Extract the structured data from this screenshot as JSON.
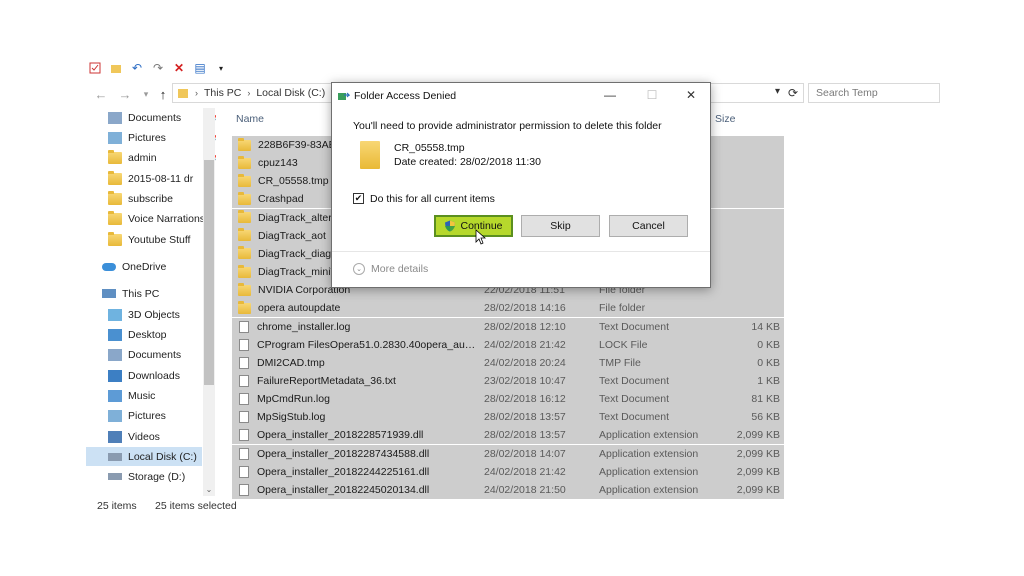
{
  "toolbar": {
    "icons": [
      "properties-icon",
      "folder-icon",
      "undo-icon",
      "redo-icon",
      "delete-icon",
      "rename-icon",
      "customize-dropdown-icon"
    ]
  },
  "address": {
    "crumbs": [
      "This PC",
      "Local Disk (C:)"
    ],
    "search_placeholder": "Search Temp"
  },
  "columns": {
    "name": "Name",
    "size": "Size"
  },
  "nav": {
    "quick_access": [
      {
        "label": "Documents",
        "pinned": true
      },
      {
        "label": "Pictures",
        "pinned": true
      },
      {
        "label": "admin",
        "pinned": true
      },
      {
        "label": "2015-08-11 dr",
        "pinned": false
      },
      {
        "label": "subscribe",
        "pinned": false
      },
      {
        "label": "Voice Narrations",
        "pinned": false
      },
      {
        "label": "Youtube Stuff",
        "pinned": false
      }
    ],
    "onedrive": "OneDrive",
    "this_pc": "This PC",
    "pc_items": [
      "3D Objects",
      "Desktop",
      "Documents",
      "Downloads",
      "Music",
      "Pictures",
      "Videos",
      "Local Disk (C:)",
      "Storage (D:)"
    ]
  },
  "files": [
    {
      "name": "228B6F39-83AB-4",
      "date": "",
      "type": "",
      "size": "",
      "kind": "folder"
    },
    {
      "name": "cpuz143",
      "date": "",
      "type": "",
      "size": "",
      "kind": "folder"
    },
    {
      "name": "CR_05558.tmp",
      "date": "",
      "type": "",
      "size": "",
      "kind": "folder"
    },
    {
      "name": "Crashpad",
      "date": "",
      "type": "",
      "size": "",
      "kind": "folder"
    },
    {
      "name": "DiagTrack_alternat",
      "date": "",
      "type": "",
      "size": "",
      "kind": "folder"
    },
    {
      "name": "DiagTrack_aot",
      "date": "",
      "type": "",
      "size": "",
      "kind": "folder"
    },
    {
      "name": "DiagTrack_diag",
      "date": "",
      "type": "",
      "size": "",
      "kind": "folder"
    },
    {
      "name": "DiagTrack_miniTra",
      "date": "",
      "type": "",
      "size": "",
      "kind": "folder"
    },
    {
      "name": "NVIDIA Corporation",
      "date": "22/02/2018 11:51",
      "type": "File folder",
      "size": "",
      "kind": "folder"
    },
    {
      "name": "opera autoupdate",
      "date": "28/02/2018 14:16",
      "type": "File folder",
      "size": "",
      "kind": "folder"
    },
    {
      "name": "chrome_installer.log",
      "date": "28/02/2018 12:10",
      "type": "Text Document",
      "size": "14 KB",
      "kind": "doc"
    },
    {
      "name": "CProgram FilesOpera51.0.2830.40opera_autou...",
      "date": "24/02/2018 21:42",
      "type": "LOCK File",
      "size": "0 KB",
      "kind": "doc"
    },
    {
      "name": "DMI2CAD.tmp",
      "date": "24/02/2018 20:24",
      "type": "TMP File",
      "size": "0 KB",
      "kind": "doc"
    },
    {
      "name": "FailureReportMetadata_36.txt",
      "date": "23/02/2018 10:47",
      "type": "Text Document",
      "size": "1 KB",
      "kind": "doc"
    },
    {
      "name": "MpCmdRun.log",
      "date": "28/02/2018 16:12",
      "type": "Text Document",
      "size": "81 KB",
      "kind": "doc"
    },
    {
      "name": "MpSigStub.log",
      "date": "28/02/2018 13:57",
      "type": "Text Document",
      "size": "56 KB",
      "kind": "doc"
    },
    {
      "name": "Opera_installer_2018228571939.dll",
      "date": "28/02/2018 13:57",
      "type": "Application extension",
      "size": "2,099 KB",
      "kind": "dll"
    },
    {
      "name": "Opera_installer_20182287434588.dll",
      "date": "28/02/2018 14:07",
      "type": "Application extension",
      "size": "2,099 KB",
      "kind": "dll"
    },
    {
      "name": "Opera_installer_20182244225161.dll",
      "date": "24/02/2018 21:42",
      "type": "Application extension",
      "size": "2,099 KB",
      "kind": "dll"
    },
    {
      "name": "Opera_installer_20182245020134.dll",
      "date": "24/02/2018 21:50",
      "type": "Application extension",
      "size": "2,099 KB",
      "kind": "dll"
    }
  ],
  "status": {
    "items": "25 items",
    "selected": "25 items selected"
  },
  "dialog": {
    "title": "Folder Access Denied",
    "message": "You'll need to provide administrator permission to delete this folder",
    "file_name": "CR_05558.tmp",
    "file_date": "Date created: 28/02/2018 11:30",
    "checkbox_label": "Do this for all current items",
    "checkbox_checked": true,
    "continue_label": "Continue",
    "skip_label": "Skip",
    "cancel_label": "Cancel",
    "more_details": "More details"
  },
  "colors": {
    "selection_row": "#cdcdcd",
    "nav_selected": "#cce1f4",
    "continue_highlight": "#b6d82c",
    "folder": "#f0c75a"
  }
}
